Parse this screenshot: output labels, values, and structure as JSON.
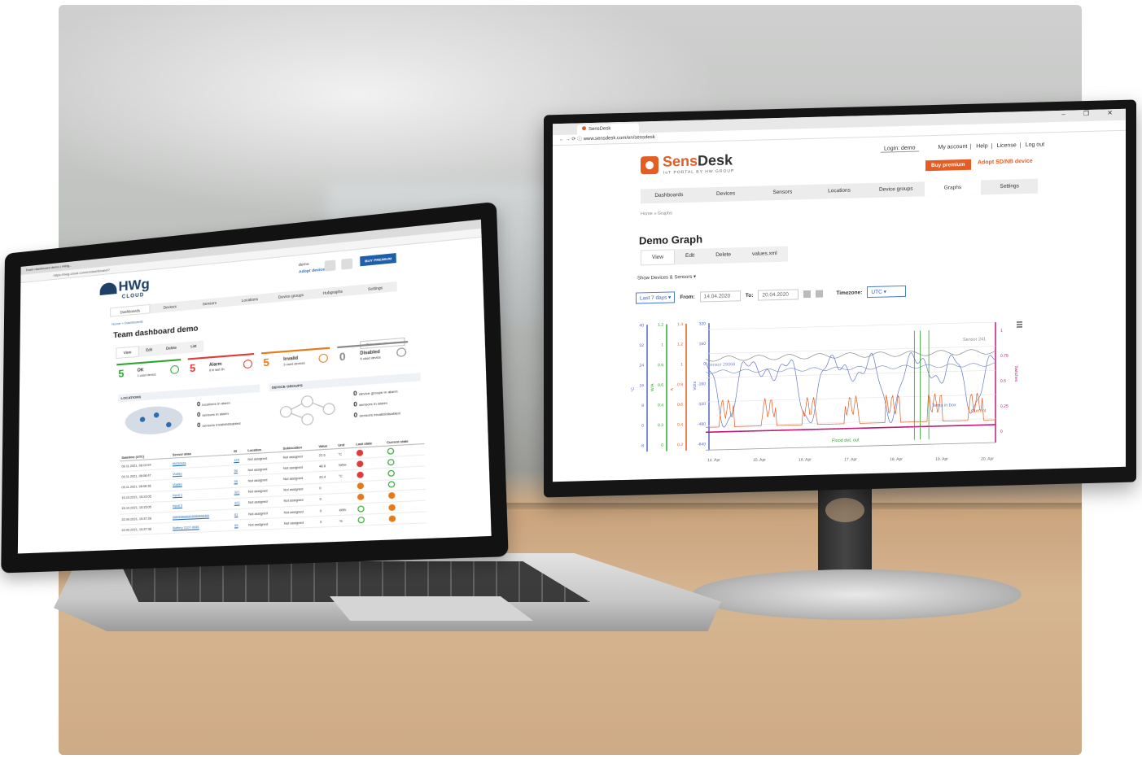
{
  "monitor": {
    "browser": {
      "tab_title": "SensDesk",
      "url": "www.sensdesk.com/en/sensdesk"
    },
    "app": {
      "logo_main": "Sens",
      "logo_accent": "Desk",
      "logo_sub": "IoT PORTAL BY HW GROUP",
      "login_label": "Login: demo",
      "top_links": [
        "My account",
        "Help",
        "License",
        "Log out"
      ],
      "buy_premium": "Buy premium",
      "adopt_link": "Adopt SD/NB device",
      "nav": [
        "Dashboards",
        "Devices",
        "Sensors",
        "Locations",
        "Device groups",
        "Graphs",
        "Settings"
      ],
      "nav_active": "Graphs",
      "breadcrumb": "Home » Graphs",
      "page_title": "Demo Graph",
      "tabs": [
        "View",
        "Edit",
        "Delete",
        "values.xml"
      ],
      "show_devices": "Show Devices & Sensors ▾",
      "range_select": "Last 7 days",
      "from_label": "From:",
      "from_value": "14.04.2020",
      "to_label": "To:",
      "to_value": "20.04.2020",
      "timezone_label": "Timezone:",
      "timezone_value": "UTC"
    },
    "chart_data": {
      "type": "line",
      "x_tick_labels": [
        "14. Apr",
        "15. Apr",
        "16. Apr",
        "17. Apr",
        "18. Apr",
        "19. Apr",
        "20. Apr"
      ],
      "series": [
        {
          "name": "Sensor 241",
          "color": "#8a8a8a"
        },
        {
          "name": "Sensor 29068",
          "color": "#7f93c9"
        },
        {
          "name": "Temp in box",
          "color": "#6676c8"
        },
        {
          "name": "Current",
          "color": "#e35d24"
        },
        {
          "name": "Flood det. out",
          "color": "#2fa52f"
        },
        {
          "name": "",
          "color": "#c2187a"
        }
      ],
      "y_axes": [
        {
          "label": "°C",
          "ticks": [
            "40",
            "32",
            "24",
            "16",
            "8",
            "0",
            "-8"
          ],
          "color": "#5566c0"
        },
        {
          "label": "W/A",
          "ticks": [
            "1.2",
            "1",
            "0.8",
            "0.6",
            "0.4",
            "0.2",
            "0"
          ],
          "color": "#2fa52f"
        },
        {
          "label": "A",
          "ticks": [
            "1.4",
            "1.2",
            "1",
            "0.8",
            "0.6",
            "0.4",
            "0.2"
          ],
          "color": "#e35d24"
        },
        {
          "label": "Volts",
          "ticks": [
            "320",
            "160",
            "0",
            "-160",
            "-320",
            "-480",
            "-640"
          ],
          "color": "#5566c0"
        }
      ],
      "y_right": {
        "label": "Switches",
        "ticks": [
          "1",
          "0.75",
          "0.5",
          "0.25",
          "0"
        ],
        "color": "#c2187a"
      }
    },
    "menu_icon": "hamburger-icon"
  },
  "laptop": {
    "browser": {
      "tab_title": "Team dashboard demo | HWg...",
      "url": "https://hwg-cloud.com/en/dashboard/7"
    },
    "logo": "HWg",
    "logo_sub": "CLOUD",
    "user": "demo",
    "adopt": "Adopt device",
    "buy": "BUY PREMIUM",
    "nav": [
      "Dashboards",
      "Devices",
      "Sensors",
      "Locations",
      "Device groups",
      "Hubgraphs",
      "Settings"
    ],
    "breadcrumb": "Home » Dashboards",
    "title": "Team dashboard demo",
    "select_dashboard": "- Select dashboard - ▾",
    "tabs": [
      "View",
      "Edit",
      "Delete",
      "List"
    ],
    "stats": [
      {
        "num": "5",
        "label": "OK",
        "sub": "1 used device",
        "color": "#2fa52f"
      },
      {
        "num": "5",
        "label": "Alarm",
        "sub": "8 in last 3h",
        "color": "#e03a3a"
      },
      {
        "num": "5",
        "label": "Invalid",
        "sub": "3 used devices",
        "color": "#e57a1a"
      },
      {
        "num": "0",
        "label": "Disabled",
        "sub": "6 used device",
        "color": "#888888"
      }
    ],
    "locations": {
      "header": "LOCATIONS",
      "lines": [
        {
          "n": "0",
          "t": "locations in alarm"
        },
        {
          "n": "0",
          "t": "sensors in alarm"
        },
        {
          "n": "0",
          "t": "sensors invalid/disabled"
        }
      ]
    },
    "device_groups": {
      "header": "DEVICE GROUPS",
      "lines": [
        {
          "n": "0",
          "t": "device groups in alarm"
        },
        {
          "n": "0",
          "t": "sensors in alarm"
        },
        {
          "n": "0",
          "t": "sensors invalid/disabled"
        }
      ]
    },
    "table": {
      "headers": [
        "Datetime (UTC)",
        "Sensor alias",
        "ID",
        "Location",
        "Sublocation",
        "Value",
        "Unit",
        "Last state",
        "Current state"
      ],
      "rows": [
        [
          "09.11.2021, 08:10:04",
          "t/k/Grisza",
          "123",
          "Not assigned",
          "Not assigned",
          "22.5",
          "°C",
          "alarm",
          "ok"
        ],
        [
          "09.11.2021, 08:08:47",
          "Vlaško",
          "56",
          "Not assigned",
          "Not assigned",
          "48.8",
          "%RH",
          "alarm",
          "ok"
        ],
        [
          "09.11.2021, 08:06:36",
          "Vlaško",
          "55",
          "Not assigned",
          "Not assigned",
          "20.4",
          "°C",
          "alarm",
          "ok"
        ],
        [
          "15.10.2021, 15:15:05",
          "Input 1",
          "321",
          "Not assigned",
          "Not assigned",
          "0",
          "",
          "invalid",
          "ok"
        ],
        [
          "15.10.2021, 15:15:05",
          "Input 3",
          "323",
          "Not assigned",
          "Not assigned",
          "0",
          "",
          "invalid",
          "invalid"
        ],
        [
          "22.09.2021, 15:37:28",
          "BBBBBBBBBBBBBBBBB",
          "61",
          "Not assigned",
          "Not assigned",
          "0",
          "kWh",
          "ok",
          "invalid"
        ],
        [
          "22.09.2021, 15:37:38",
          "Battery 3107-9681",
          "65",
          "Not assigned",
          "Not assigned",
          "0",
          "%",
          "ok",
          "invalid"
        ]
      ]
    }
  }
}
